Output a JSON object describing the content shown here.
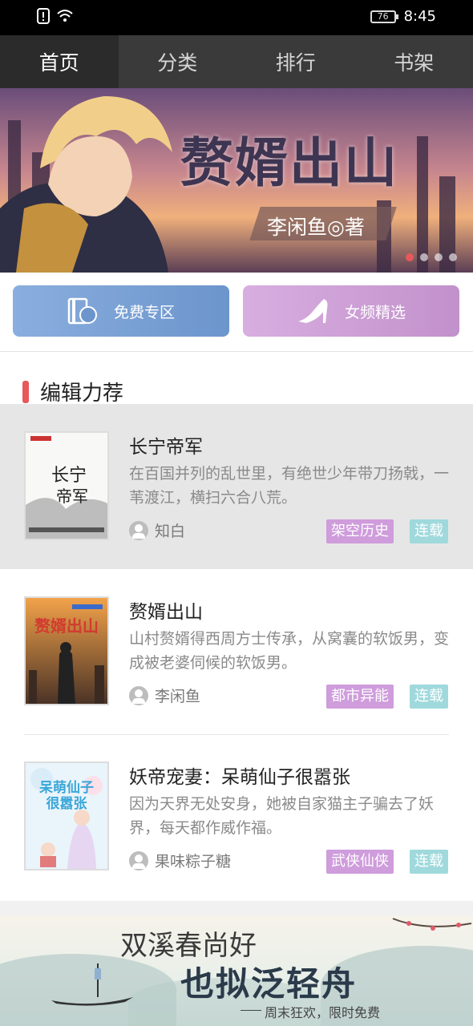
{
  "status_bar": {
    "battery": "76",
    "time": "8:45"
  },
  "tabs": [
    {
      "label": "首页",
      "active": true
    },
    {
      "label": "分类",
      "active": false
    },
    {
      "label": "排行",
      "active": false
    },
    {
      "label": "书架",
      "active": false
    }
  ],
  "banner": {
    "title": "赘婿出山",
    "author": "李闲鱼◎著",
    "slide_count": 4,
    "active_slide": 1
  },
  "quick_links": {
    "free": {
      "label": "免费专区",
      "icon_text": "免"
    },
    "female": {
      "label": "女频精选"
    }
  },
  "section": {
    "title": "编辑力荐"
  },
  "books": [
    {
      "title": "长宁帝军",
      "desc": "在百国并列的乱世里，有绝世少年带刀扬戟，一苇渡江，横扫六合八荒。",
      "author": "知白",
      "genre": "架空历史",
      "status": "连载",
      "cover_text": "长宁帝军"
    },
    {
      "title": "赘婿出山",
      "desc": "山村赘婿得西周方士传承，从窝囊的软饭男，变成被老婆伺候的软饭男。",
      "author": "李闲鱼",
      "genre": "都市异能",
      "status": "连载",
      "cover_text": "赘婿出山"
    },
    {
      "title": "妖帝宠妻：呆萌仙子很嚣张",
      "desc": "因为天界无处安身，她被自家猫主子骗去了妖界，每天都作威作福。",
      "author": "果味粽子糖",
      "genre": "武侠仙侠",
      "status": "连载",
      "cover_text": "呆萌仙子很嚣张"
    }
  ],
  "bottom_banner": {
    "line1": "双溪春尚好",
    "line2": "也拟泛轻舟",
    "promo": "周末狂欢，限时免费"
  },
  "colors": {
    "accent": "#e6585a",
    "tab_bar": "#3a3a3a",
    "genre_tag": "#cf9cdc",
    "status_tag": "#9fd9dc"
  }
}
